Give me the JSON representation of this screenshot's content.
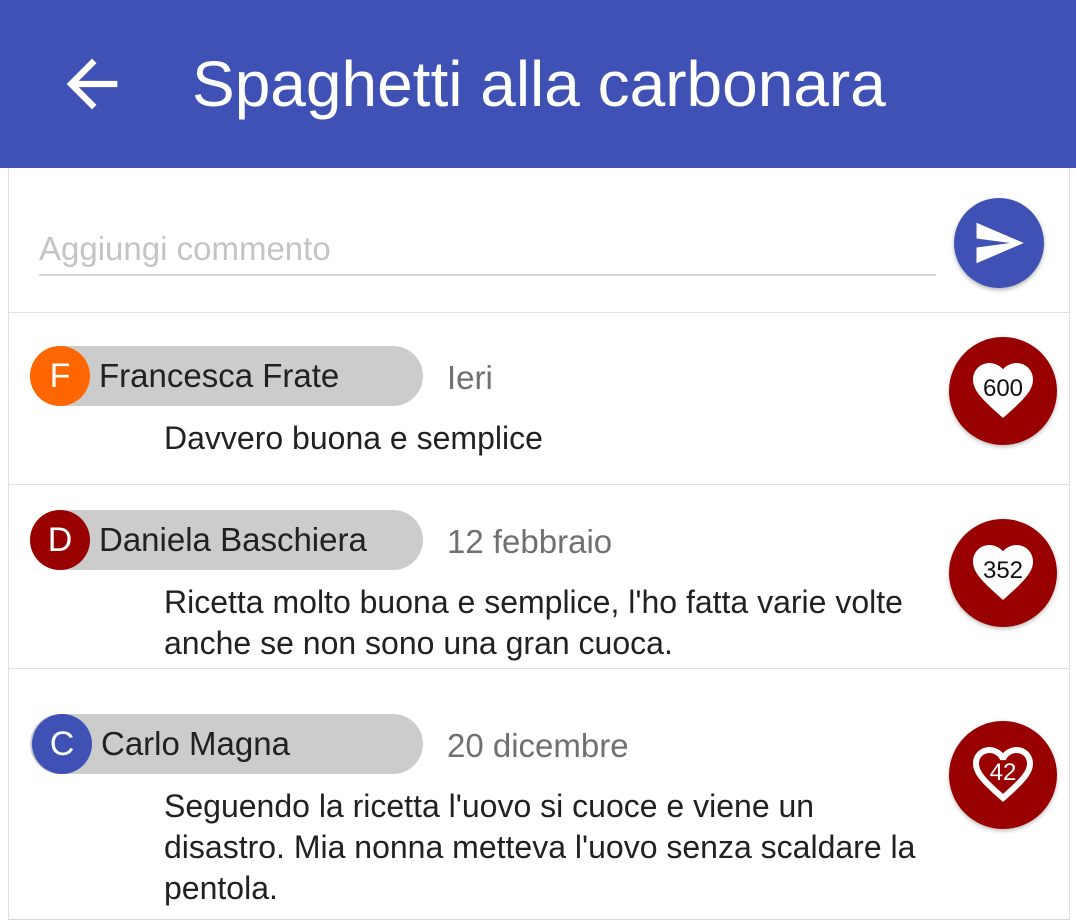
{
  "appbar": {
    "title": "Spaghetti alla carbonara",
    "color": "#3f51b5"
  },
  "composer": {
    "placeholder": "Aggiungi commento",
    "value": ""
  },
  "comments": [
    {
      "avatar_letter": "F",
      "avatar_color": "#ff6600",
      "author": "Francesca Frate",
      "date": "Ieri",
      "text": "Davvero buona e semplice",
      "likes": "600",
      "liked": true
    },
    {
      "avatar_letter": "D",
      "avatar_color": "#990000",
      "author": "Daniela Baschiera",
      "date": "12 febbraio",
      "text": "Ricetta molto buona e semplice, l'ho fatta varie volte anche se non sono una gran cuoca.",
      "likes": "352",
      "liked": true
    },
    {
      "avatar_letter": "C",
      "avatar_color": "#3f51b5",
      "author": "Carlo Magna",
      "date": "20 dicembre",
      "text": "Seguendo la ricetta l'uovo si cuoce e viene un disastro. Mia nonna metteva l'uovo senza scaldare la pentola.",
      "likes": "42",
      "liked": false
    }
  ],
  "colors": {
    "like_button": "#990000",
    "chip_background": "#cccccc"
  }
}
